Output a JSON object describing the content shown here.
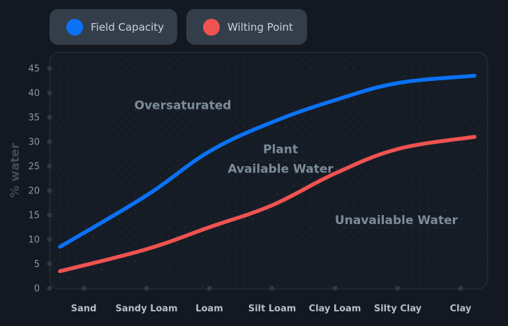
{
  "legend": {
    "field_capacity": "Field Capacity",
    "wilting_point": "Wilting Point"
  },
  "colors": {
    "background": "#131821",
    "plot_bg": "#161c26",
    "field_capacity": "#0a72f5",
    "wilting_point": "#ef5350",
    "button_bg": "#333e4a",
    "annotation": "#7c8b9a",
    "axis_text": "#b5bec8"
  },
  "chart_data": {
    "type": "line",
    "categories": [
      "Sand",
      "Sandy Loam",
      "Loam",
      "Silt Loam",
      "Clay Loam",
      "Silty Clay",
      "Clay"
    ],
    "series": [
      {
        "name": "Field Capacity",
        "values": [
          8.5,
          19,
          28,
          34,
          38.5,
          42,
          43.5
        ]
      },
      {
        "name": "Wilting Point",
        "values": [
          3.5,
          8,
          12.5,
          17,
          23.5,
          28.5,
          31
        ]
      }
    ],
    "ylabel": "% water",
    "ylim": [
      0,
      45
    ],
    "yticks": [
      "0",
      "5",
      "10",
      "15",
      "20",
      "25",
      "30",
      "35",
      "40",
      "45"
    ],
    "annotations": [
      {
        "text": "Oversaturated",
        "x": "Loam",
        "y": 37.5
      },
      {
        "text": "Plant",
        "x": "Silt Loam",
        "y": 28.5
      },
      {
        "text": "Available Water",
        "x": "Silt Loam",
        "y": 24.5
      },
      {
        "text": "Unavailable Water",
        "x": "Clay Loam",
        "y": 14
      }
    ],
    "grid": "dotted",
    "legend_position": "top-left"
  }
}
